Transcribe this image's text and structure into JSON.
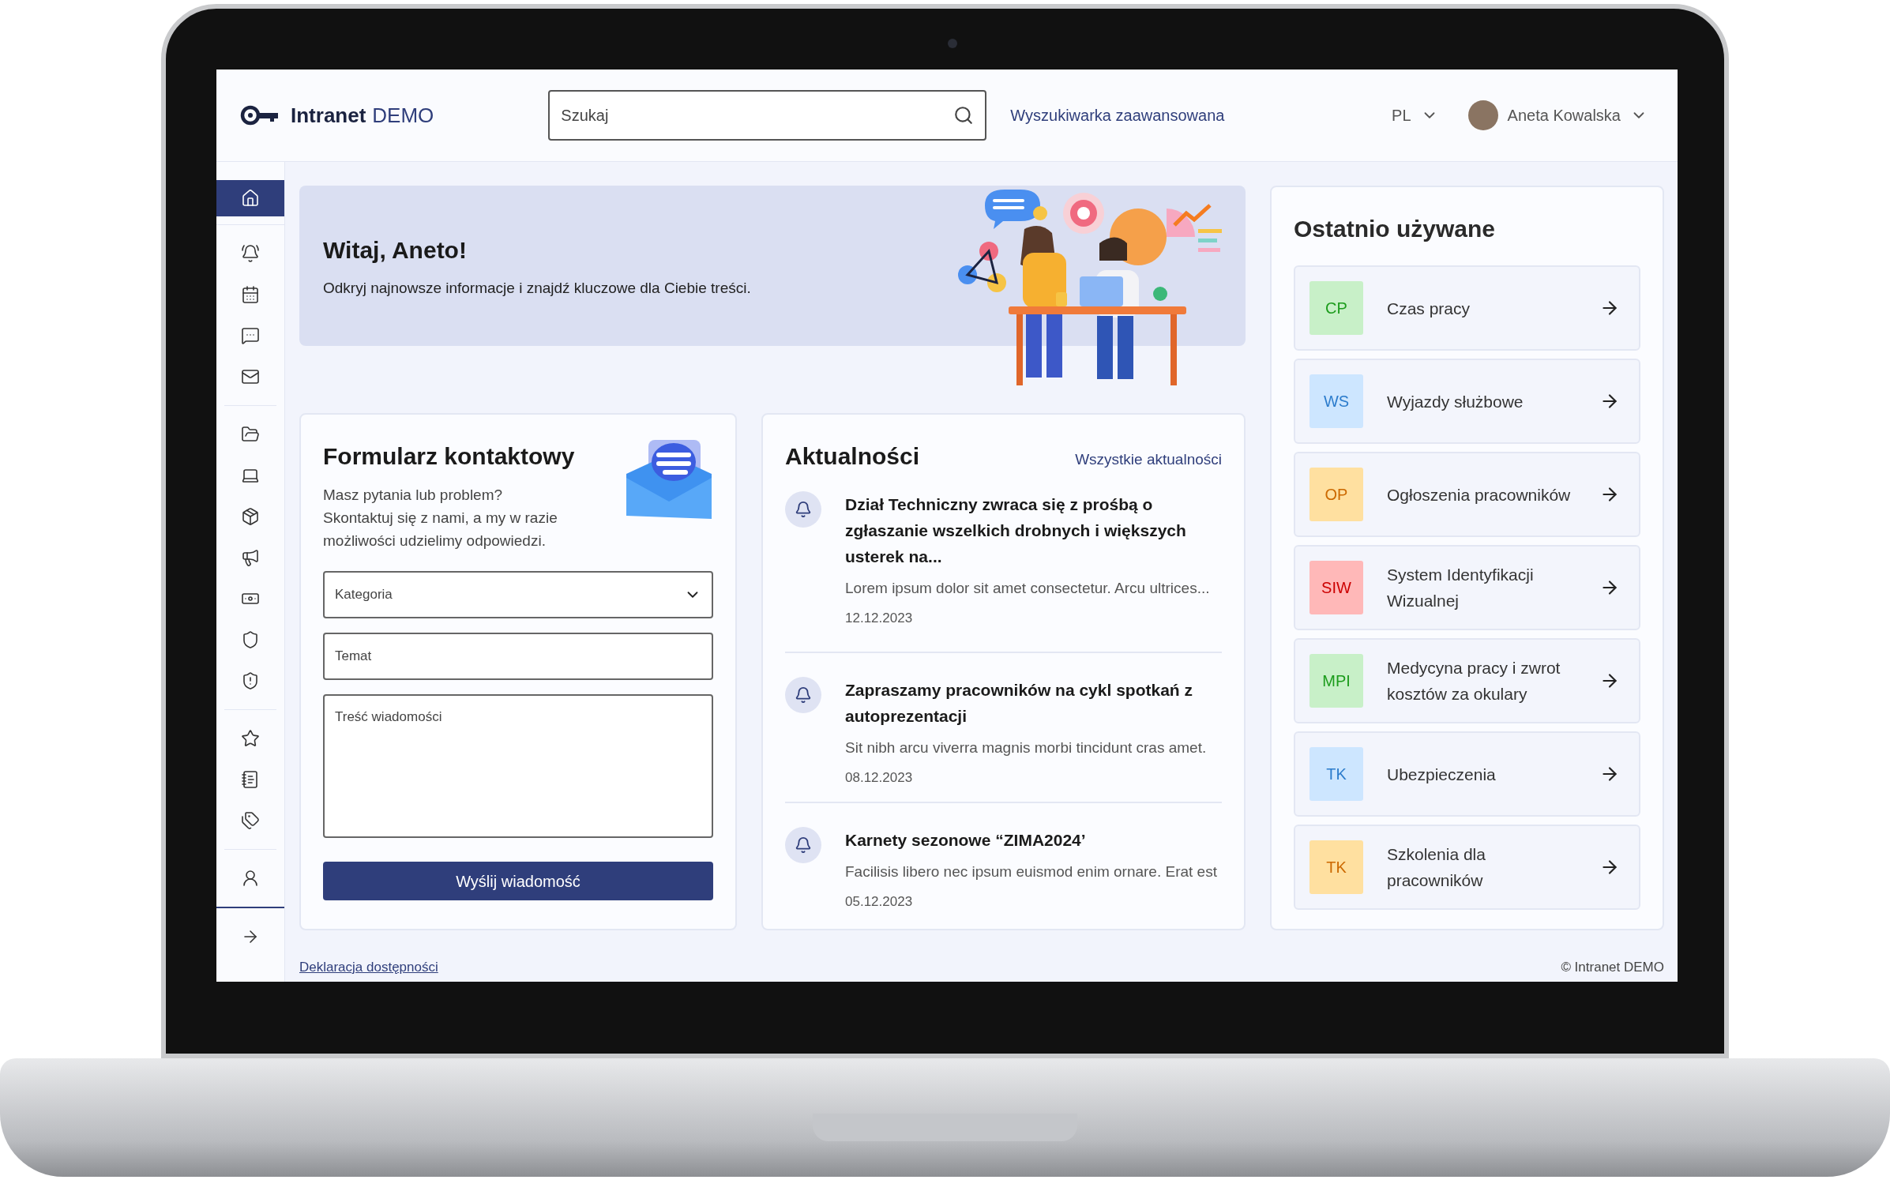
{
  "header": {
    "logo_text": "Intranet",
    "logo_accent": "DEMO",
    "search": {
      "placeholder": "Szukaj"
    },
    "advanced_search": "Wyszukiwarka zaawansowana",
    "language": "PL",
    "user": "Aneta Kowalska"
  },
  "sidebar": {
    "groups": [
      {
        "items": [
          {
            "selected": true
          }
        ]
      },
      {
        "items": [
          {
            "selected": false
          },
          {
            "selected": false
          },
          {
            "selected": false
          },
          {
            "selected": false
          }
        ]
      },
      {
        "items": [
          {
            "selected": false
          },
          {
            "selected": false
          },
          {
            "selected": false
          },
          {
            "selected": false
          },
          {
            "selected": false
          },
          {
            "selected": false
          },
          {
            "selected": false
          }
        ]
      },
      {
        "items": [
          {
            "selected": false
          },
          {
            "selected": false
          },
          {
            "selected": false
          }
        ]
      },
      {
        "items": [
          {
            "selected": false
          }
        ]
      },
      {
        "items": [
          {
            "selected": false
          }
        ]
      }
    ]
  },
  "welcome": {
    "title": "Witaj, Aneto!",
    "text": "Odkryj najnowsze informacje i znajdź kluczowe dla Ciebie treści."
  },
  "contact_form": {
    "title": "Formularz kontaktowy",
    "text": "Masz pytania lub problem? Skontaktuj się z nami, a my w razie możliwości udzielimy odpowiedzi.",
    "category": {
      "placeholder": "Kategoria"
    },
    "subject": {
      "placeholder": "Temat"
    },
    "message": {
      "placeholder": "Treść wiadomości"
    },
    "submit": "Wyślij wiadomość"
  },
  "news": {
    "title": "Aktualności",
    "all_link": "Wszystkie aktualności",
    "items": [
      {
        "title": "Dział Techniczny zwraca się z prośbą o zgłaszanie wszelkich drobnych i większych usterek na...",
        "text": "Lorem ipsum dolor sit amet consectetur. Arcu ultrices...",
        "date": "12.12.2023"
      },
      {
        "title": "Zapraszamy pracowników na cykl spotkań z autoprezentacji",
        "text": "Sit nibh arcu viverra magnis morbi tincidunt cras amet.",
        "date": "08.12.2023"
      },
      {
        "title": "Karnety sezonowe “ZIMA2024’",
        "text": "Facilisis libero nec ipsum euismod enim ornare. Erat est",
        "date": "05.12.2023"
      }
    ]
  },
  "recent": {
    "title": "Ostatnio używane",
    "items": [
      {
        "badge": "CP",
        "label": "Czas pracy",
        "color": "#c8f0c8"
      },
      {
        "badge": "WS",
        "label": "Wyjazdy służbowe",
        "color": "#cde6ff"
      },
      {
        "badge": "OP",
        "label": "Ogłoszenia pracowników",
        "color": "#ffe0a0"
      },
      {
        "badge": "SIW",
        "label": "System Identyfikacji Wizualnej",
        "color": "#ffb8b8"
      },
      {
        "badge": "MPI",
        "label": "Medycyna pracy i zwrot kosztów za okulary",
        "color": "#c8f0c8"
      },
      {
        "badge": "TK",
        "label": "Ubezpieczenia",
        "color": "#cde6ff"
      },
      {
        "badge": "TK",
        "label": "Szkolenia dla pracowników",
        "color": "#ffe0a0"
      }
    ]
  },
  "footer": {
    "accessibility": "Deklaracja dostępności",
    "copyright": "© Intranet DEMO"
  }
}
